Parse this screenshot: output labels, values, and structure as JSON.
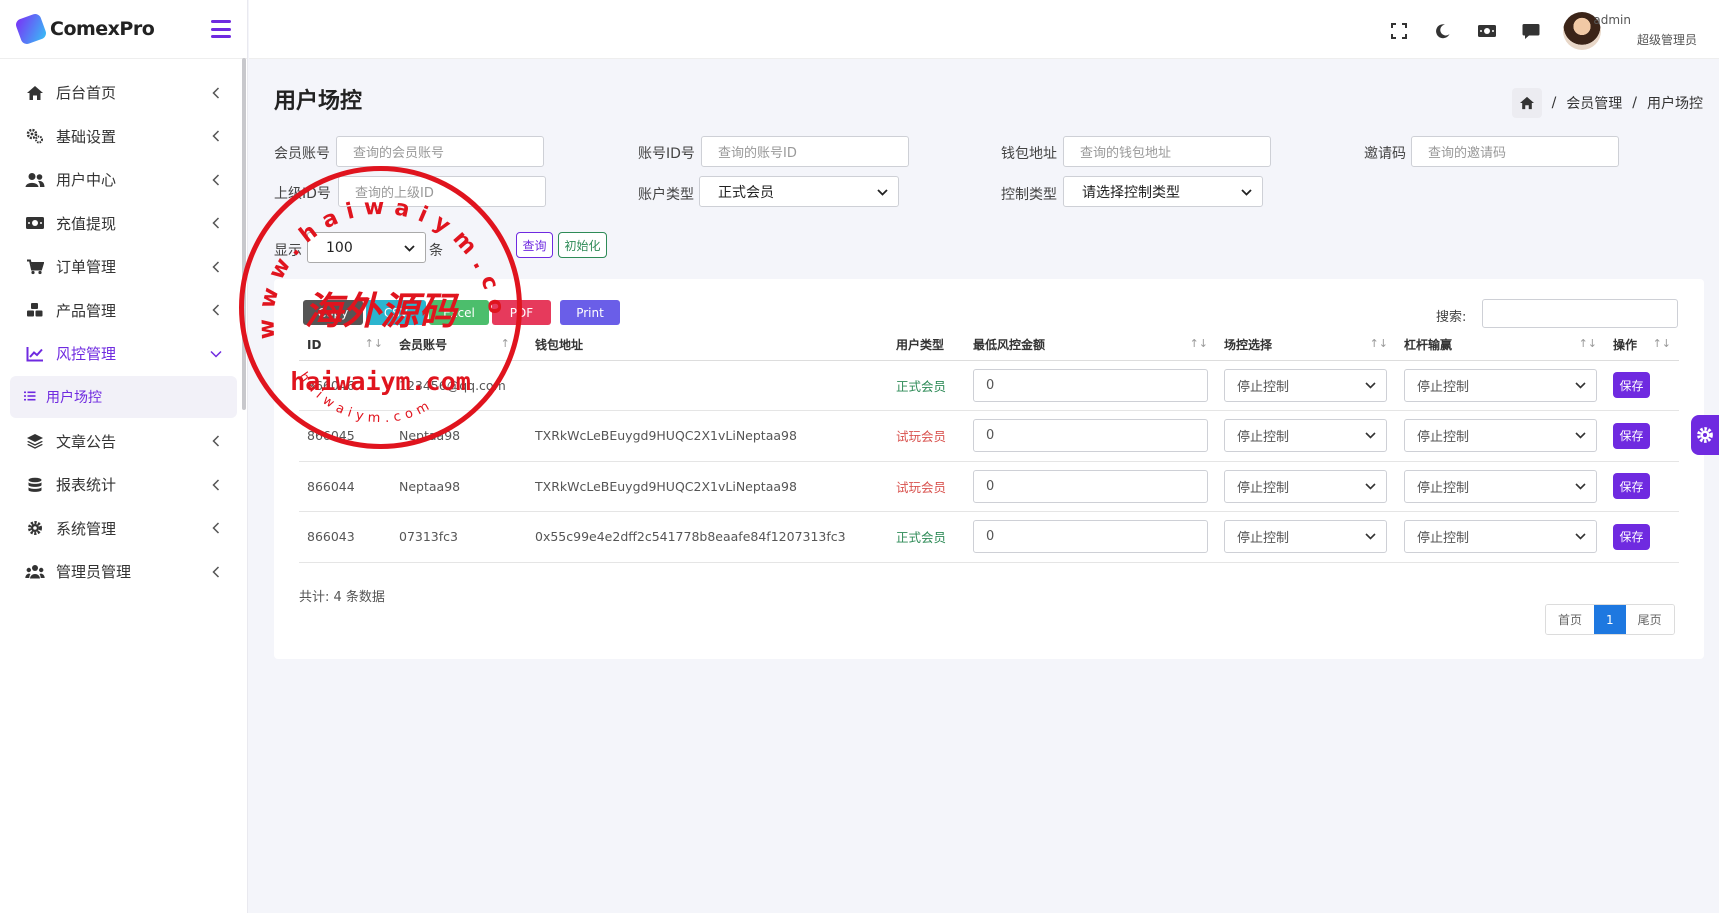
{
  "brand": {
    "name": "ComexPro"
  },
  "sidebar": {
    "items": [
      {
        "label": "后台首页",
        "icon": "home-icon"
      },
      {
        "label": "基础设置",
        "icon": "cogs-icon"
      },
      {
        "label": "用户中心",
        "icon": "users-icon"
      },
      {
        "label": "充值提现",
        "icon": "money-icon"
      },
      {
        "label": "订单管理",
        "icon": "cart-icon"
      },
      {
        "label": "产品管理",
        "icon": "cubes-icon"
      },
      {
        "label": "风控管理",
        "icon": "chart-line-icon",
        "active": true
      },
      {
        "label": "文章公告",
        "icon": "layers-icon"
      },
      {
        "label": "报表统计",
        "icon": "database-icon"
      },
      {
        "label": "系统管理",
        "icon": "gear-icon"
      },
      {
        "label": "管理员管理",
        "icon": "user-group-icon"
      }
    ],
    "sub_item": {
      "label": "用户场控"
    }
  },
  "topbar": {
    "user_name": "admin",
    "user_role": "超级管理员"
  },
  "page": {
    "title": "用户场控",
    "breadcrumb": [
      "会员管理",
      "用户场控"
    ]
  },
  "filters": {
    "member_account": {
      "label": "会员账号",
      "placeholder": "查询的会员账号"
    },
    "account_id": {
      "label": "账号ID号",
      "placeholder": "查询的账号ID"
    },
    "wallet": {
      "label": "钱包地址",
      "placeholder": "查询的钱包地址"
    },
    "invite": {
      "label": "邀请码",
      "placeholder": "查询的邀请码"
    },
    "parent_id": {
      "label": "上级ID号",
      "placeholder": "查询的上级ID"
    },
    "account_type": {
      "label": "账户类型",
      "value": "正式会员"
    },
    "control_type": {
      "label": "控制类型",
      "value": "请选择控制类型"
    },
    "show_label": "显示",
    "show_value": "100",
    "show_unit": "条",
    "query_btn": "查询",
    "reset_btn": "初始化"
  },
  "export_buttons": {
    "copy": "Copy",
    "csv": "CSV",
    "excel": "Excel",
    "pdf": "PDF",
    "print": "Print"
  },
  "search_label": "搜索:",
  "table": {
    "headers": [
      "ID",
      "会员账号",
      "钱包地址",
      "用户类型",
      "最低风控金额",
      "场控选择",
      "杠杆输赢",
      "操作"
    ],
    "rows": [
      {
        "id": "866046",
        "account": "123456@qq.com",
        "wallet": "",
        "type": "正式会员",
        "min_amount": "0",
        "control": "停止控制",
        "leverage": "停止控制",
        "action": "保存"
      },
      {
        "id": "866045",
        "account": "Neptaa98",
        "wallet": "TXRkWcLeBEuygd9HUQC2X1vLiNeptaa98",
        "type": "试玩会员",
        "min_amount": "0",
        "control": "停止控制",
        "leverage": "停止控制",
        "action": "保存"
      },
      {
        "id": "866044",
        "account": "Neptaa98",
        "wallet": "TXRkWcLeBEuygd9HUQC2X1vLiNeptaa98",
        "type": "试玩会员",
        "min_amount": "0",
        "control": "停止控制",
        "leverage": "停止控制",
        "action": "保存"
      },
      {
        "id": "866043",
        "account": "07313fc3",
        "wallet": "0x55c99e4e2dff2c541778b8eaafe84f1207313fc3",
        "type": "正式会员",
        "min_amount": "0",
        "control": "停止控制",
        "leverage": "停止控制",
        "action": "保存"
      }
    ]
  },
  "footer": {
    "total": "共计: 4 条数据",
    "pager": {
      "first": "首页",
      "current": "1",
      "last": "尾页"
    }
  },
  "watermark": {
    "top_arc": "www.haiwaiym.com",
    "center": "海外源码",
    "main": "haiwaiym.com",
    "bottom_arc": "haiwaiym.com"
  },
  "colors": {
    "accent": "#6f2ae0",
    "stamp": "#e0141e",
    "active_page": "#1e78e0"
  }
}
